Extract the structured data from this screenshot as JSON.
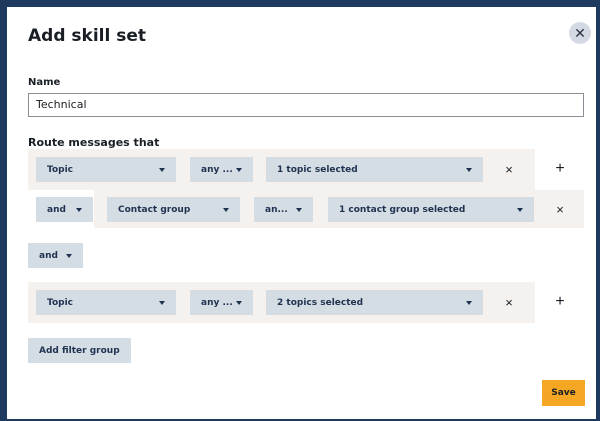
{
  "modal": {
    "title": "Add skill set",
    "close_icon": "close-icon"
  },
  "name_field": {
    "label": "Name",
    "value": "Technical"
  },
  "route": {
    "label": "Route messages that"
  },
  "group1": {
    "row1": {
      "field": "Topic",
      "operator": "any ...",
      "value": "1 topic selected"
    },
    "row2": {
      "conjunction": "and",
      "field": "Contact group",
      "operator": "an...",
      "value": "1 contact group selected"
    }
  },
  "group_conjunction": "and",
  "group2": {
    "row1": {
      "field": "Topic",
      "operator": "any ...",
      "value": "2 topics selected"
    }
  },
  "buttons": {
    "add_filter_group": "Add filter group",
    "save": "Save"
  },
  "icons": {
    "remove": "×",
    "add": "+"
  },
  "colors": {
    "accent": "#f5a623",
    "dropdown_bg": "#d4dce4",
    "group_bg": "#f4f1ef"
  }
}
